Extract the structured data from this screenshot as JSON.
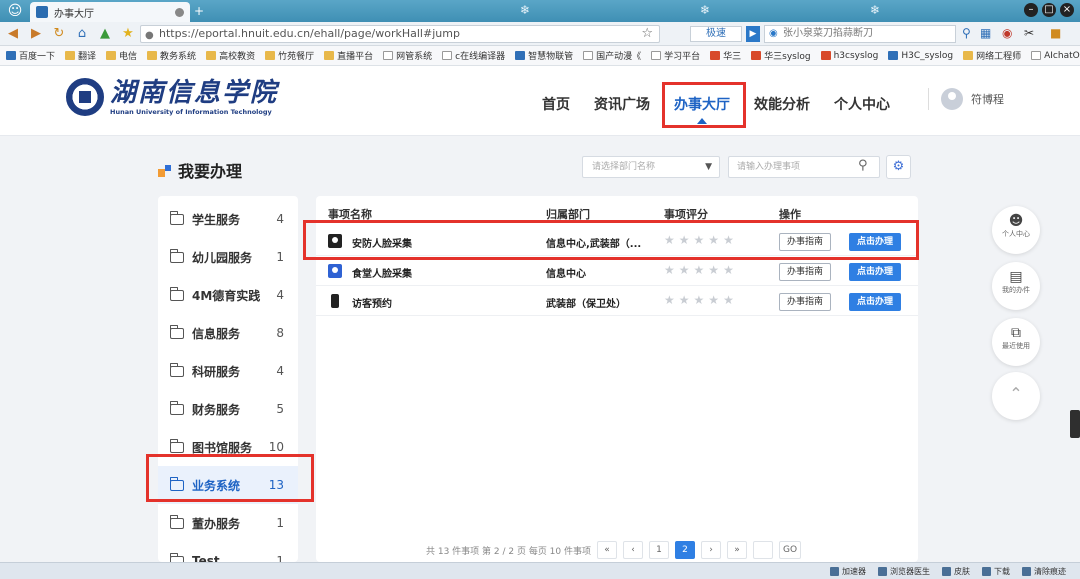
{
  "browser": {
    "tab_title": "办事大厅",
    "url": "https://eportal.hnuit.edu.cn/ehall/page/workHall#jump",
    "speed_label": "极速",
    "search_text": "张小泉菜刀掐蒜断刀",
    "bookmarks": [
      "百度一下",
      "翻译",
      "电信",
      "教务系统",
      "高校教资",
      "竹苑餐厅",
      "直播平台",
      "网管系统",
      "c在线编译器",
      "智慧物联管",
      "国产动漫《",
      "学习平台",
      "华三",
      "华三syslog",
      "h3csyslog",
      "H3C_syslog",
      "网络工程师",
      "AIchatOS"
    ],
    "status_items": [
      "加速器",
      "浏览器医生",
      "皮肤",
      "下载",
      "清除痕迹"
    ]
  },
  "header": {
    "logo_cn": "湖南信息学院",
    "logo_en": "Hunan University of Information Technology",
    "nav": [
      "首页",
      "资讯广场",
      "办事大厅",
      "效能分析",
      "个人中心"
    ],
    "active_nav": "办事大厅",
    "user_name": "符博程"
  },
  "section": {
    "title": "我要办理",
    "dept_placeholder": "请选择部门名称",
    "search_placeholder": "请输入办理事项"
  },
  "sidebar": {
    "items": [
      {
        "label": "学生服务",
        "count": "4"
      },
      {
        "label": "幼儿园服务",
        "count": "1"
      },
      {
        "label": "4M德育实践",
        "count": "4"
      },
      {
        "label": "信息服务",
        "count": "8"
      },
      {
        "label": "科研服务",
        "count": "4"
      },
      {
        "label": "财务服务",
        "count": "5"
      },
      {
        "label": "图书馆服务",
        "count": "10"
      },
      {
        "label": "业务系统",
        "count": "13"
      },
      {
        "label": "董办服务",
        "count": "1"
      },
      {
        "label": "Test",
        "count": "1"
      }
    ],
    "active": "业务系统"
  },
  "table": {
    "headers": [
      "事项名称",
      "归属部门",
      "事项评分",
      "操作"
    ],
    "rows": [
      {
        "name": "安防人脸采集",
        "dept": "信息中心,武装部（...",
        "guide": "办事指南",
        "go": "点击办理",
        "icon": "face-capture-icon"
      },
      {
        "name": "食堂人脸采集",
        "dept": "信息中心",
        "guide": "办事指南",
        "go": "点击办理",
        "icon": "user-card-icon"
      },
      {
        "name": "访客预约",
        "dept": "武装部（保卫处）",
        "guide": "办事指南",
        "go": "点击办理",
        "icon": "door-icon"
      }
    ],
    "rating_stars": 5
  },
  "pagination": {
    "summary": "共 13 件事项  第 2 / 2 页  每页 10 件事项",
    "first": "«",
    "prev": "‹",
    "pages": [
      "1",
      "2"
    ],
    "current": "2",
    "next": "›",
    "last": "»",
    "go": "GO"
  },
  "rail": [
    {
      "label": "个人中心",
      "icon": "person-icon"
    },
    {
      "label": "我的办件",
      "icon": "document-icon"
    },
    {
      "label": "最近使用",
      "icon": "recent-icon"
    }
  ],
  "colors": {
    "accent": "#1e63c4",
    "primary_button": "#2f7fe3",
    "highlight": "#e4322b"
  }
}
